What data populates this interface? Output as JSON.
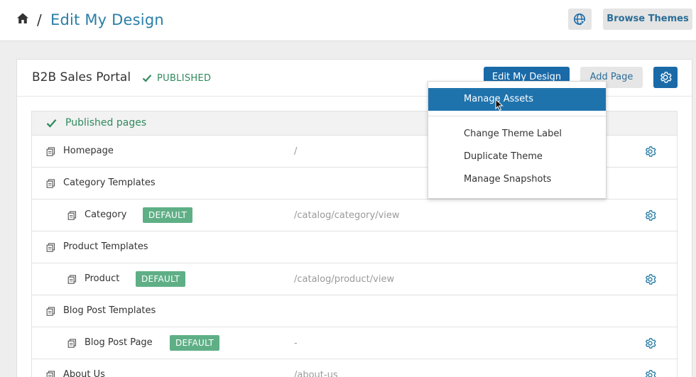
{
  "header": {
    "breadcrumb_sep": "/",
    "title": "Edit My Design",
    "browse_label": "Browse Themes",
    "icons": [
      "home-icon",
      "globe-cursor-icon"
    ]
  },
  "portal": {
    "name": "B2B Sales Portal",
    "status": "PUBLISHED",
    "edit_label": "Edit My Design",
    "add_page_label": "Add Page"
  },
  "table": {
    "group_label": "Published pages",
    "rows": [
      {
        "name": "Homepage",
        "path": "/",
        "level": 0,
        "badge": "",
        "has_settings": true
      },
      {
        "name": "Category Templates",
        "path": "",
        "level": 0,
        "badge": "",
        "has_settings": false
      },
      {
        "name": "Category",
        "path": "/catalog/category/view",
        "level": 1,
        "badge": "DEFAULT",
        "has_settings": true
      },
      {
        "name": "Product Templates",
        "path": "",
        "level": 0,
        "badge": "",
        "has_settings": false
      },
      {
        "name": "Product",
        "path": "/catalog/product/view",
        "level": 1,
        "badge": "DEFAULT",
        "has_settings": true
      },
      {
        "name": "Blog Post Templates",
        "path": "",
        "level": 0,
        "badge": "",
        "has_settings": false
      },
      {
        "name": "Blog Post Page",
        "path": "-",
        "level": 1,
        "badge": "DEFAULT",
        "has_settings": true
      },
      {
        "name": "About Us",
        "path": "/about-us",
        "level": 0,
        "badge": "",
        "has_settings": true
      }
    ]
  },
  "menu": {
    "items": [
      "Manage Assets",
      "Change Theme Label",
      "Duplicate Theme",
      "Manage Snapshots"
    ],
    "active_index": 0
  },
  "colors": {
    "accent": "#1a6aa8",
    "title_blue": "#2a7ea6",
    "published_green": "#2f8a5e",
    "badge_green": "#5faf86"
  }
}
